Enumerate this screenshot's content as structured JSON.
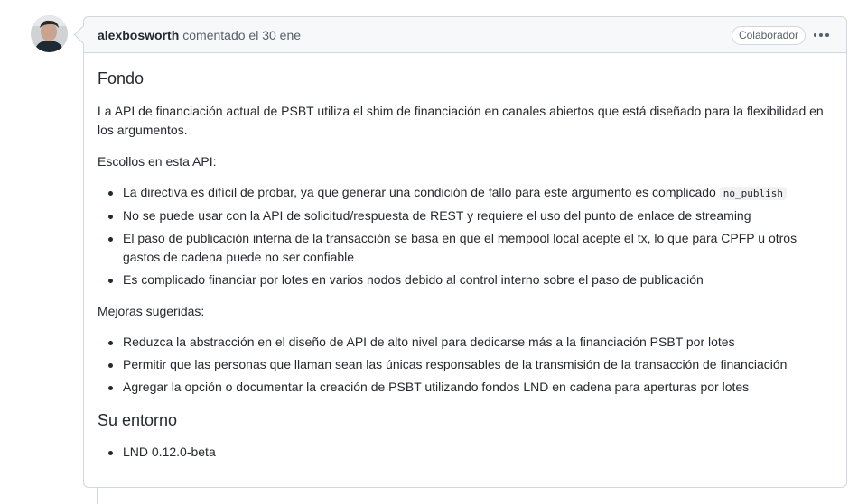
{
  "comment": {
    "author": "alexbosworth",
    "action": "comentado el 30 ene",
    "badge": "Colaborador",
    "sections": {
      "fondo_title": "Fondo",
      "fondo_text": "La API de financiación actual de PSBT utiliza el shim de financiación en canales abiertos que está diseñado para la flexibilidad en los argumentos.",
      "escollos_label": "Escollos en esta API:",
      "escollos": [
        {
          "text": "La directiva es difícil de probar, ya que generar una condición de fallo para este argumento es complicado ",
          "code": "no_publish"
        },
        {
          "text": "No se puede usar con la API de solicitud/respuesta de REST y requiere el uso del punto de enlace de streaming"
        },
        {
          "text": "El paso de publicación interna de la transacción se basa en que el mempool local acepte el tx, lo que para CPFP u otros gastos de cadena puede no ser confiable"
        },
        {
          "text": "Es complicado financiar por lotes en varios nodos debido al control interno sobre el paso de publicación"
        }
      ],
      "mejoras_label": "Mejoras sugeridas:",
      "mejoras": [
        "Reduzca la abstracción en el diseño de API de alto nivel para dedicarse más a la financiación PSBT por lotes",
        "Permitir que las personas que llaman sean las únicas responsables de la transmisión de la transacción de financiación",
        "Agregar la opción o documentar la creación de PSBT utilizando fondos LND en cadena para aperturas por lotes"
      ],
      "entorno_title": "Su entorno",
      "entorno": [
        "LND 0.12.0-beta"
      ]
    }
  }
}
